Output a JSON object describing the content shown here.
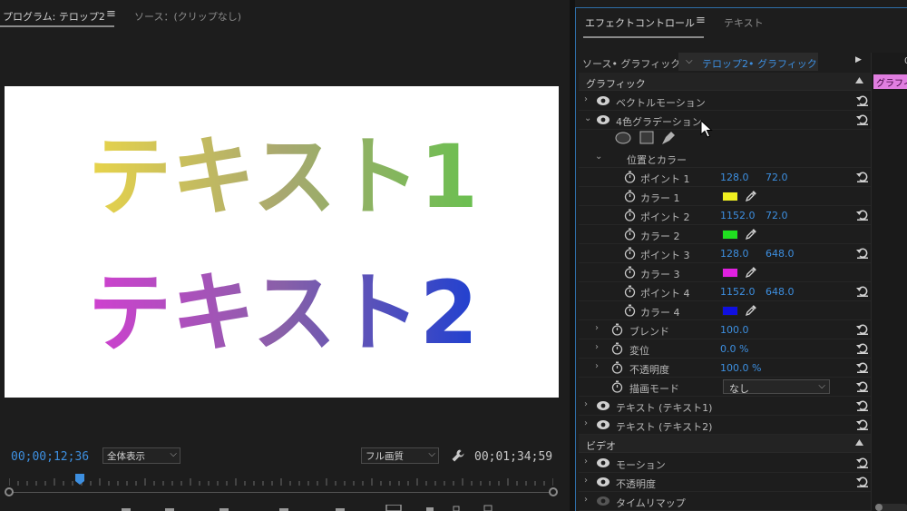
{
  "program_monitor": {
    "tab_program": "プログラム: テロップ2",
    "tab_program_menu": "≡",
    "tab_source": "ソース：(クリップなし)",
    "overlay_text_1": "テキスト1",
    "overlay_text_2": "テキスト2",
    "timecode_current": "00;00;12;36",
    "timecode_duration": "00;01;34;59",
    "zoom_dropdown": "全体表示",
    "quality_dropdown": "フル画質",
    "playhead_fraction": 0.13
  },
  "effect_controls": {
    "tab_effect": "エフェクトコントロール",
    "tab_effect_menu": "≡",
    "tab_text": "テキスト",
    "source_label": "ソース• グラフィック",
    "clip_name": "テロップ2• グラフィック",
    "timeline_zero": "0",
    "timeline_clip_label": "グラフィック",
    "section_graphic": "グラフィック",
    "vector_motion": "ベクトルモーション",
    "four_color_gradient": "4色グラデーション",
    "position_and_color": "位置とカラー",
    "point1_label": "ポイント 1",
    "point1_x": "128.0",
    "point1_y": "72.0",
    "color1_label": "カラー 1",
    "point2_label": "ポイント 2",
    "point2_x": "1152.0",
    "point2_y": "72.0",
    "color2_label": "カラー 2",
    "point3_label": "ポイント 3",
    "point3_x": "128.0",
    "point3_y": "648.0",
    "color3_label": "カラー 3",
    "point4_label": "ポイント 4",
    "point4_x": "1152.0",
    "point4_y": "648.0",
    "color4_label": "カラー 4",
    "blend_label": "ブレンド",
    "blend_value": "100.0",
    "jitter_label": "変位",
    "jitter_value": "0.0 %",
    "opacity_label": "不透明度",
    "opacity_value": "100.0 %",
    "blend_mode_label": "描画モード",
    "blend_mode_value": "なし",
    "text1_layer": "テキスト (テキスト1)",
    "text2_layer": "テキスト (テキスト2)",
    "section_video": "ビデオ",
    "motion": "モーション",
    "video_opacity": "不透明度",
    "time_remap": "タイムリマップ"
  },
  "colors": {
    "accent_blue": "#3d8fe0",
    "color1": "#f0f020",
    "color2": "#20e020",
    "color3": "#e020e0",
    "color4": "#1010e0",
    "timeline_clip": "#e07ee0"
  }
}
